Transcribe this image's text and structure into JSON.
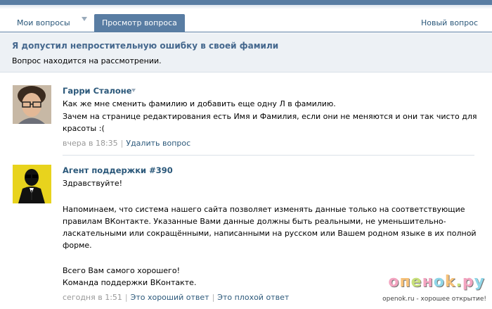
{
  "tabs": {
    "my_questions": "Мои вопросы",
    "view_question": "Просмотр вопроса",
    "new_question": "Новый вопрос"
  },
  "question": {
    "title": "Я допустил непростительную ошибку в своей фамили",
    "status": "Вопрос находится на рассмотрении."
  },
  "messages": [
    {
      "author": "Гарри Сталоне",
      "lines": [
        "Как же мне сменить фамилию и добавить еще одну Л в фамилию.",
        "Зачем на странице редактирования есть Имя и Фамилия, если они не меняются и они так чисто для",
        "красоты :("
      ],
      "time": "вчера в 18:35",
      "actions": [
        "Удалить вопрос"
      ]
    },
    {
      "author": "Агент поддержки #390",
      "lines": [
        "Здравствуйте!",
        "",
        "Напоминаем, что система нашего сайта позволяет изменять данные только на соответствующие",
        "правилам ВКонтакте. Указанные Вами данные должны быть реальными, не уменьшительно-",
        "ласкательными или сокращёнными, написанными на русском или Вашем родном языке в их полной",
        "форме.",
        "",
        "Всего Вам самого хорошего!",
        "Команда поддержки ВКонтакте."
      ],
      "time": "сегодня в 1:51",
      "actions": [
        "Это хороший ответ",
        "Это плохой ответ"
      ]
    }
  ],
  "watermark": {
    "logo": "oпeнok.py",
    "caption": "openok.ru - хорошее открытие!"
  },
  "colors": {
    "accent": "#597da3",
    "link": "#2b587a",
    "title": "#45688e",
    "support_avatar_bg": "#e8d31d"
  }
}
